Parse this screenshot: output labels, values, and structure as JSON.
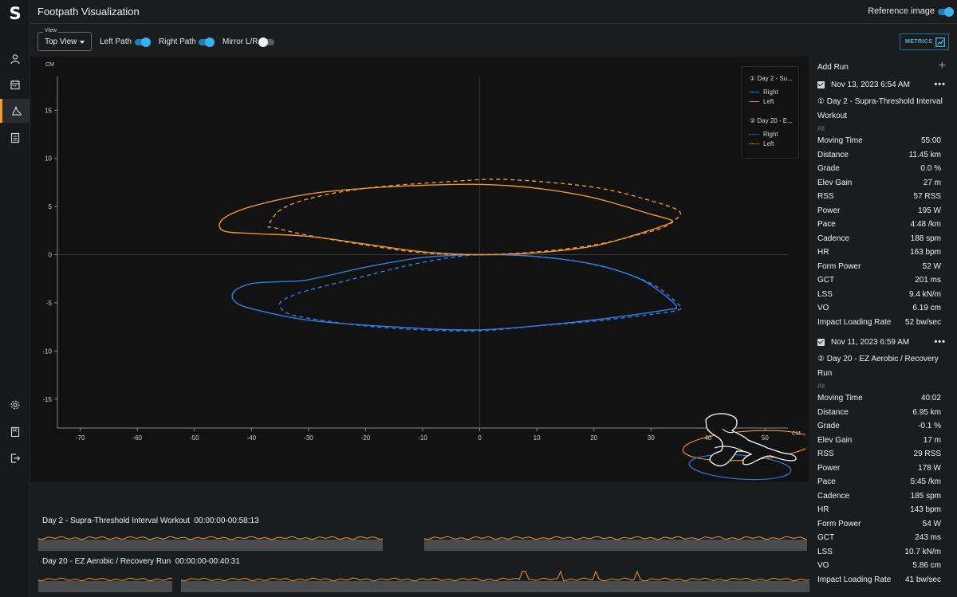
{
  "app": {
    "logo": "S",
    "title": "Footpath Visualization",
    "reference_image_label": "Reference image",
    "reference_image_on": true
  },
  "nav": [
    {
      "icon": "user-icon",
      "active": false
    },
    {
      "icon": "calendar-icon",
      "active": false
    },
    {
      "icon": "footpath-icon",
      "active": true
    },
    {
      "icon": "report-icon",
      "active": false
    },
    {
      "icon": "settings-icon",
      "active": false
    },
    {
      "icon": "book-icon",
      "active": false
    },
    {
      "icon": "logout-icon",
      "active": false
    }
  ],
  "controls": {
    "view_legend": "View",
    "view_value": "Top View",
    "left_path_label": "Left Path",
    "left_path_on": true,
    "right_path_label": "Right Path",
    "right_path_on": true,
    "mirror_label": "Mirror L/R",
    "mirror_on": false,
    "metrics_label": "METRICS"
  },
  "legend": {
    "run1_title": "① Day 2 - Su...",
    "run2_title": "② Day 20 - E...",
    "right_label": "Right",
    "left_label": "Left"
  },
  "colors": {
    "right": "#2f7fe6",
    "left": "#f0962e",
    "accent": "#3ab2ef"
  },
  "chart_data": {
    "type": "line",
    "xlabel": "CM",
    "ylabel": "CM",
    "xlim": [
      -74,
      54
    ],
    "ylim": [
      -18,
      18.5
    ],
    "xticks": [
      -70,
      -60,
      -50,
      -40,
      -30,
      -20,
      -10,
      0,
      10,
      20,
      30,
      40,
      50
    ],
    "yticks": [
      -15,
      -10,
      -5,
      0,
      5,
      10,
      15
    ],
    "grid": false,
    "legend_position": "top-right",
    "series": [
      {
        "name": "Right",
        "run": "① Day 2 - Su...",
        "style": "solid",
        "color": "#2f7fe6",
        "x": [
          0,
          10,
          20,
          28,
          33,
          34.5,
          33,
          25,
          15,
          0,
          -15,
          -30,
          -40,
          -43,
          -43,
          -40,
          -35,
          -30,
          -20,
          -10,
          0
        ],
        "y": [
          0,
          -0.2,
          -1,
          -2.5,
          -4.5,
          -5.5,
          -5.7,
          -6.4,
          -7.1,
          -7.8,
          -7.5,
          -6.8,
          -5.6,
          -4.8,
          -3.8,
          -3.0,
          -2.8,
          -2.6,
          -1.3,
          -0.3,
          0
        ]
      },
      {
        "name": "Left",
        "run": "① Day 2 - Su...",
        "style": "solid",
        "color": "#f0962e",
        "x": [
          0,
          10,
          20,
          28,
          33,
          33.5,
          30,
          20,
          10,
          0,
          -10,
          -20,
          -30,
          -40,
          -45,
          -45,
          -40,
          -30,
          -20,
          -10,
          0
        ],
        "y": [
          0,
          0.2,
          0.9,
          2.2,
          3.2,
          3.6,
          4.2,
          5.9,
          6.9,
          7.3,
          7.2,
          6.9,
          6.3,
          5.0,
          3.7,
          2.5,
          2.2,
          1.9,
          1.1,
          0.3,
          0
        ]
      },
      {
        "name": "Right",
        "run": "② Day 20 - E...",
        "style": "dashed",
        "color": "#2f7fe6",
        "x": [
          0,
          12,
          22,
          30,
          34.5,
          35,
          30,
          20,
          10,
          0,
          -10,
          -20,
          -30,
          -34,
          -35,
          -33,
          -30,
          -20,
          -10,
          0
        ],
        "y": [
          0,
          -0.3,
          -1.3,
          -3.0,
          -5.0,
          -5.7,
          -6.2,
          -6.9,
          -7.4,
          -7.9,
          -7.8,
          -7.4,
          -6.6,
          -6.0,
          -5.0,
          -4.3,
          -3.7,
          -2.2,
          -0.8,
          0
        ]
      },
      {
        "name": "Left",
        "run": "② Day 20 - E...",
        "style": "dashed",
        "color": "#f0962e",
        "x": [
          0,
          10,
          20,
          28,
          32,
          34,
          35,
          30,
          20,
          5,
          -5,
          -20,
          -30,
          -35,
          -37,
          -36,
          -30,
          -20,
          -10,
          0
        ],
        "y": [
          0,
          0.3,
          1.0,
          2.1,
          2.8,
          3.5,
          4.5,
          5.6,
          7.0,
          7.8,
          7.6,
          6.9,
          5.8,
          4.6,
          3.0,
          2.8,
          2.0,
          1.0,
          0.2,
          0
        ]
      }
    ]
  },
  "runs": [
    {
      "date": "Nov 13, 2023 6:54 AM",
      "name": "① Day 2 - Supra-Threshold Interval Workout",
      "all": "All",
      "metrics": [
        {
          "label": "Moving Time",
          "value": "55:00"
        },
        {
          "label": "Distance",
          "value": "11.45 km"
        },
        {
          "label": "Grade",
          "value": "0.0 %"
        },
        {
          "label": "Elev Gain",
          "value": "27 m"
        },
        {
          "label": "RSS",
          "value": "57 RSS"
        },
        {
          "label": "Power",
          "value": "195 W"
        },
        {
          "label": "Pace",
          "value": "4:48 /km"
        },
        {
          "label": "Cadence",
          "value": "188 spm"
        },
        {
          "label": "HR",
          "value": "163 bpm"
        },
        {
          "label": "Form Power",
          "value": "52 W"
        },
        {
          "label": "GCT",
          "value": "201 ms"
        },
        {
          "label": "LSS",
          "value": "9.4 kN/m"
        },
        {
          "label": "VO",
          "value": "6.19 cm"
        },
        {
          "label": "Impact Loading Rate",
          "value": "52 bw/sec"
        }
      ]
    },
    {
      "date": "Nov 11, 2023 6:59 AM",
      "name": "② Day 20 - EZ Aerobic / Recovery Run",
      "all": "All",
      "metrics": [
        {
          "label": "Moving Time",
          "value": "40:02"
        },
        {
          "label": "Distance",
          "value": "6.95 km"
        },
        {
          "label": "Grade",
          "value": "-0.1 %"
        },
        {
          "label": "Elev Gain",
          "value": "17 m"
        },
        {
          "label": "RSS",
          "value": "29 RSS"
        },
        {
          "label": "Power",
          "value": "178 W"
        },
        {
          "label": "Pace",
          "value": "5:45 /km"
        },
        {
          "label": "Cadence",
          "value": "185 spm"
        },
        {
          "label": "HR",
          "value": "143 bpm"
        },
        {
          "label": "Form Power",
          "value": "54 W"
        },
        {
          "label": "GCT",
          "value": "243 ms"
        },
        {
          "label": "LSS",
          "value": "10.7 kN/m"
        },
        {
          "label": "VO",
          "value": "5.86 cm"
        },
        {
          "label": "Impact Loading Rate",
          "value": "41 bw/sec"
        }
      ]
    }
  ],
  "side": {
    "add_run_label": "Add Run"
  },
  "timelines": [
    {
      "label": "Day 2 - Supra-Threshold Interval Workout  00:00:00-00:58:13"
    },
    {
      "label": "Day 20 - EZ Aerobic / Recovery Run  00:00:00-00:40:31"
    }
  ]
}
